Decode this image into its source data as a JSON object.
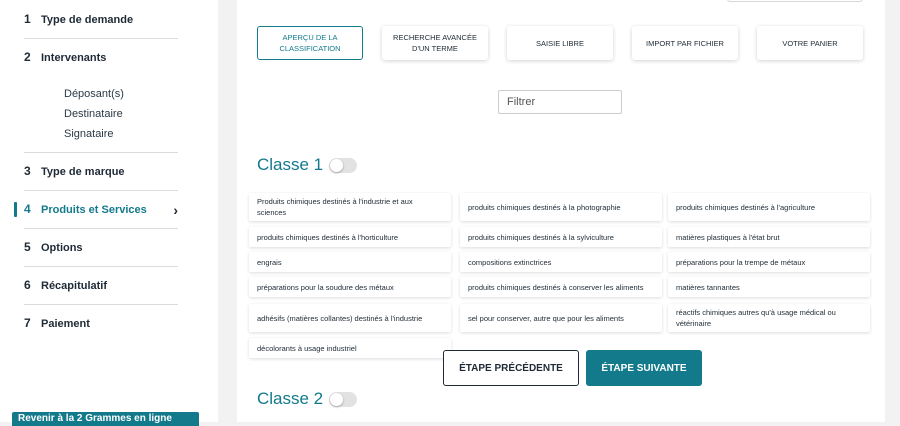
{
  "sidebar": {
    "steps": [
      {
        "num": "1",
        "label": "Type de demande"
      },
      {
        "num": "2",
        "label": "Intervenants"
      },
      {
        "num": "3",
        "label": "Type de marque"
      },
      {
        "num": "4",
        "label": "Produits et Services"
      },
      {
        "num": "5",
        "label": "Options"
      },
      {
        "num": "6",
        "label": "Récapitulatif"
      },
      {
        "num": "7",
        "label": "Paiement"
      }
    ],
    "sub_items": [
      "Déposant(s)",
      "Destinataire",
      "Signataire"
    ],
    "bottom_button": "Revenir à la 2 Grammes en ligne"
  },
  "tabs": [
    {
      "label": "APERÇU DE LA CLASSIFICATION"
    },
    {
      "label": "RECHERCHE AVANCÉE D'UN TERME"
    },
    {
      "label": "SAISIE LIBRE"
    },
    {
      "label": "IMPORT PAR FICHIER"
    },
    {
      "label": "VOTRE PANIER"
    }
  ],
  "filter": {
    "placeholder": "Filtrer"
  },
  "classes": [
    {
      "title": "Classe 1"
    },
    {
      "title": "Classe 2"
    }
  ],
  "terms": [
    "Produits chimiques destinés à l'industrie et aux sciences",
    "produits chimiques destinés à la photographie",
    "produits chimiques destinés à l'agriculture",
    "produits chimiques destinés à l'horticulture",
    "produits chimiques destinés à la sylviculture",
    "matières plastiques à l'état brut",
    "engrais",
    "compositions extinctrices",
    "préparations pour la trempe de métaux",
    "préparations pour la soudure des métaux",
    "produits chimiques destinés à conserver les aliments",
    "matières tannantes",
    "adhésifs (matières collantes) destinés à l'industrie",
    "sel pour conserver, autre que pour les aliments",
    "réactifs chimiques autres qu'à usage médical ou vétérinaire",
    "décolorants à usage industriel"
  ],
  "nav": {
    "previous": "ÉTAPE PRÉCÉDENTE",
    "next": "ÉTAPE SUIVANTE"
  },
  "colors": {
    "accent": "#137a8c",
    "text": "#1e2a35",
    "background": "#f2f2f2"
  }
}
